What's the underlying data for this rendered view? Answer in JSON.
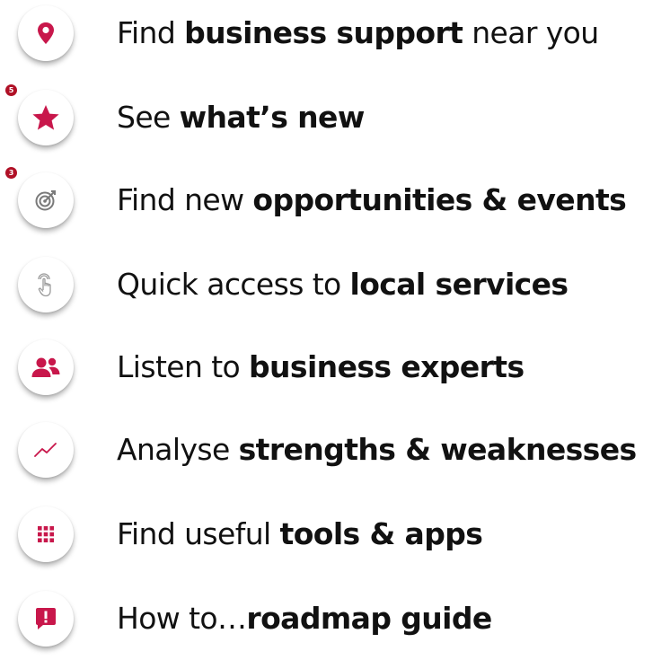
{
  "accent_color": "#c8174b",
  "menu": {
    "items": [
      {
        "icon": "location-pin-icon",
        "text": "Find ",
        "bold": "business support",
        "suffix": " near you",
        "badge": null
      },
      {
        "icon": "star-icon",
        "text": "See ",
        "bold": "what’s new",
        "suffix": "",
        "badge": "5"
      },
      {
        "icon": "target-icon",
        "text": "Find new ",
        "bold": "opportunities & events",
        "suffix": "",
        "badge": "3"
      },
      {
        "icon": "touch-hand-icon",
        "text": "Quick access to ",
        "bold": "local services",
        "suffix": "",
        "badge": null
      },
      {
        "icon": "people-icon",
        "text": "Listen to ",
        "bold": "business experts",
        "suffix": "",
        "badge": null
      },
      {
        "icon": "trend-line-icon",
        "text": "Analyse ",
        "bold": "strengths & weaknesses",
        "suffix": "",
        "badge": null
      },
      {
        "icon": "grid-apps-icon",
        "text": "Find useful ",
        "bold": "tools & apps",
        "suffix": "",
        "badge": null
      },
      {
        "icon": "alert-speech-bubble-icon",
        "text": "How to…",
        "bold": "roadmap guide",
        "suffix": "",
        "badge": null
      }
    ]
  }
}
